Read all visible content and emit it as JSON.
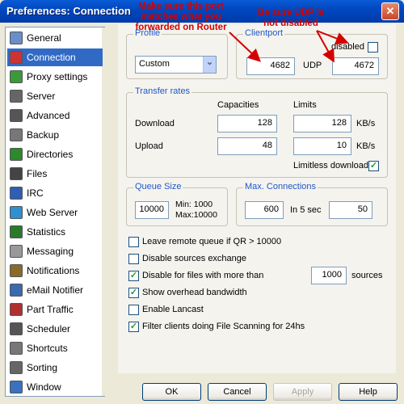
{
  "window": {
    "title": "Preferences: Connection",
    "close_symbol": "✕"
  },
  "sidebar": {
    "items": [
      {
        "label": "General",
        "icon": "general-icon"
      },
      {
        "label": "Connection",
        "icon": "connection-icon",
        "selected": true
      },
      {
        "label": "Proxy settings",
        "icon": "proxy-icon"
      },
      {
        "label": "Server",
        "icon": "server-icon"
      },
      {
        "label": "Advanced",
        "icon": "advanced-icon"
      },
      {
        "label": "Backup",
        "icon": "backup-icon"
      },
      {
        "label": "Directories",
        "icon": "directories-icon"
      },
      {
        "label": "Files",
        "icon": "files-icon"
      },
      {
        "label": "IRC",
        "icon": "irc-icon"
      },
      {
        "label": "Web Server",
        "icon": "web-server-icon"
      },
      {
        "label": "Statistics",
        "icon": "statistics-icon"
      },
      {
        "label": "Messaging",
        "icon": "messaging-icon"
      },
      {
        "label": "Notifications",
        "icon": "notifications-icon"
      },
      {
        "label": "eMail Notifier",
        "icon": "email-notifier-icon"
      },
      {
        "label": "Part Traffic",
        "icon": "part-traffic-icon"
      },
      {
        "label": "Scheduler",
        "icon": "scheduler-icon"
      },
      {
        "label": "Shortcuts",
        "icon": "shortcuts-icon"
      },
      {
        "label": "Sorting",
        "icon": "sorting-icon"
      },
      {
        "label": "Window",
        "icon": "window-icon"
      }
    ]
  },
  "profile": {
    "group_label": "Profile",
    "value": "Custom",
    "arrow": "⌄"
  },
  "clientport": {
    "group_label": "Clientport",
    "tcp_value": "4682",
    "udp_label": "UDP",
    "udp_value": "4672",
    "disabled_label": "disabled",
    "disabled_checked": false
  },
  "transfer": {
    "group_label": "Transfer rates",
    "capacities_header": "Capacities",
    "limits_header": "Limits",
    "download_label": "Download",
    "upload_label": "Upload",
    "download_capacity": "128",
    "download_limit": "128",
    "upload_capacity": "48",
    "upload_limit": "10",
    "unit": "KB/s",
    "limitless_label": "Limitless download",
    "limitless_checked": true
  },
  "queue": {
    "group_label": "Queue Size",
    "value": "10000",
    "min_text": "Min:  1000",
    "max_text": "Max:10000"
  },
  "maxconn": {
    "group_label": "Max. Connections",
    "value": "600",
    "in5sec_label": "In 5 sec",
    "in5sec_value": "50"
  },
  "options": [
    {
      "label": "Leave remote queue if QR > 10000",
      "checked": false
    },
    {
      "label": "Disable sources exchange",
      "checked": false
    },
    {
      "label": "Disable for files with more than",
      "checked": true
    },
    {
      "label": "Show overhead bandwidth",
      "checked": true
    },
    {
      "label": "Enable Lancast",
      "checked": false
    },
    {
      "label": "Filter clients doing File Scanning for 24hs",
      "checked": true
    }
  ],
  "sources": {
    "value": "1000",
    "label": "sources"
  },
  "buttons": {
    "ok": "OK",
    "cancel": "Cancel",
    "apply": "Apply",
    "help": "Help"
  },
  "annotations": {
    "port_note_1": "Make sure this port",
    "port_note_2": "matches what you",
    "port_note_3": "forwarded on Router",
    "udp_note_1": "Be sure UDP is",
    "udp_note_2": "not disabled"
  },
  "check_mark": "✓",
  "colors": {
    "accent": "#316ac5",
    "annotation": "#d40000",
    "group_title": "#2158c8"
  }
}
